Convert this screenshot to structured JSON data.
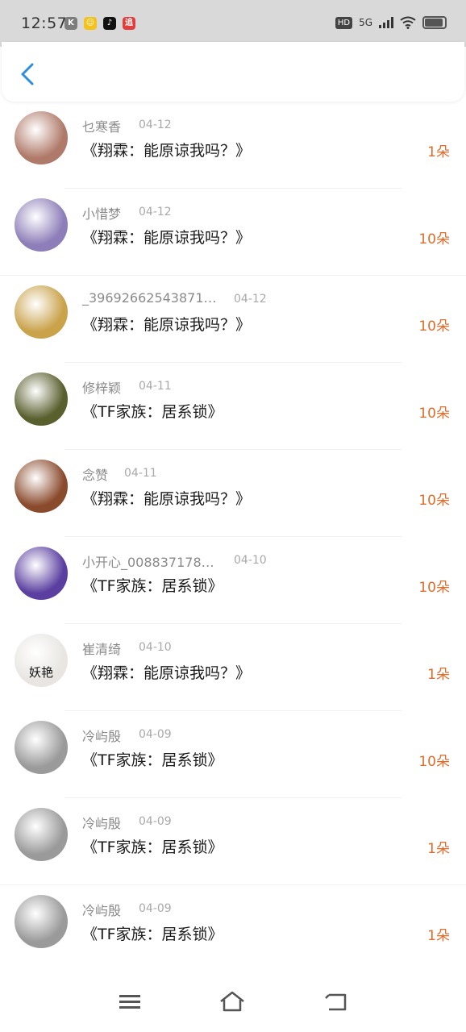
{
  "status_bar": {
    "time": "12:57",
    "apps": [
      {
        "icon": "k-app-icon",
        "glyph": "K",
        "color": "#7d7d7d"
      },
      {
        "icon": "smiley-app-icon",
        "glyph": "☺",
        "color": "#f4c21b"
      },
      {
        "icon": "tiktok-app-icon",
        "glyph": "♪",
        "color": "#111111"
      },
      {
        "icon": "red-app-icon",
        "glyph": "追",
        "color": "#e23d3d"
      }
    ],
    "hd": "HD",
    "network": "5G"
  },
  "messages": [
    {
      "name": "乜寒香",
      "date": "04-12",
      "title": "《翔霖：能原谅我吗？》",
      "count": "1朵",
      "avatar_color": "#b07a6a",
      "avatar_text": ""
    },
    {
      "name": "小惜梦",
      "date": "04-12",
      "title": "《翔霖：能原谅我吗？》",
      "count": "10朵",
      "avatar_color": "#8d7db8",
      "avatar_text": ""
    },
    {
      "name": "_396926625438​71…",
      "date": "04-12",
      "title": "《翔霖：能原谅我吗？》",
      "count": "10朵",
      "avatar_color": "#c9a24a",
      "avatar_text": ""
    },
    {
      "name": "修梓颖",
      "date": "04-11",
      "title": "《TF家族：居系锁》",
      "count": "10朵",
      "avatar_color": "#5a5f2e",
      "avatar_text": ""
    },
    {
      "name": "念赞",
      "date": "04-11",
      "title": "《翔霖：能原谅我吗？》",
      "count": "10朵",
      "avatar_color": "#8a4b2d",
      "avatar_text": ""
    },
    {
      "name": "小开心_008837178…",
      "date": "04-10",
      "title": "《TF家族：居系锁》",
      "count": "10朵",
      "avatar_color": "#5b3fa0",
      "avatar_text": ""
    },
    {
      "name": "崔清绮",
      "date": "04-10",
      "title": "《翔霖：能原谅我吗？》",
      "count": "1朵",
      "avatar_color": "#e9e6e2",
      "avatar_text": "妖艳"
    },
    {
      "name": "冷屿殷",
      "date": "04-09",
      "title": "《TF家族：居系锁》",
      "count": "10朵",
      "avatar_color": "#9a9a9a",
      "avatar_text": ""
    },
    {
      "name": "冷屿殷",
      "date": "04-09",
      "title": "《TF家族：居系锁》",
      "count": "1朵",
      "avatar_color": "#9a9a9a",
      "avatar_text": ""
    },
    {
      "name": "冷屿殷",
      "date": "04-09",
      "title": "《TF家族：居系锁》",
      "count": "1朵",
      "avatar_color": "#9a9a9a",
      "avatar_text": ""
    }
  ],
  "colors": {
    "accent": "#2a8fe0",
    "count": "#e06c2a"
  }
}
